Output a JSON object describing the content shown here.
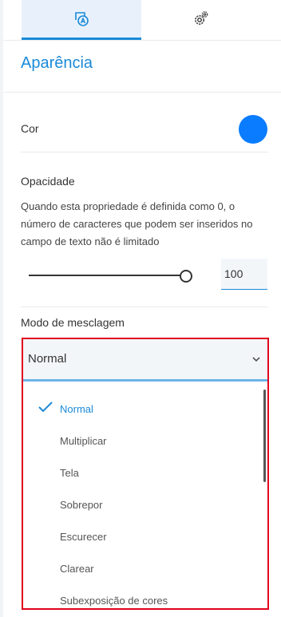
{
  "tabs": [
    {
      "icon": "appearance-icon",
      "active": true
    },
    {
      "icon": "gear-icon",
      "active": false
    }
  ],
  "section": {
    "title": "Aparência"
  },
  "color": {
    "label": "Cor",
    "value": "#0a7cff"
  },
  "opacity": {
    "label": "Opacidade",
    "description": "Quando esta propriedade é definida como 0, o número de caracteres que podem ser inseridos no campo de texto não é limitado",
    "value": "100",
    "slider_percent": 100
  },
  "blend_mode": {
    "label": "Modo de mesclagem",
    "selected": "Normal",
    "options": [
      "Normal",
      "Multiplicar",
      "Tela",
      "Sobrepor",
      "Escurecer",
      "Clarear",
      "Subexposição de cores"
    ]
  },
  "colors": {
    "accent": "#1a8ad8",
    "highlight_border": "#e0001c",
    "tab_active_bg": "#e8f1fb"
  }
}
